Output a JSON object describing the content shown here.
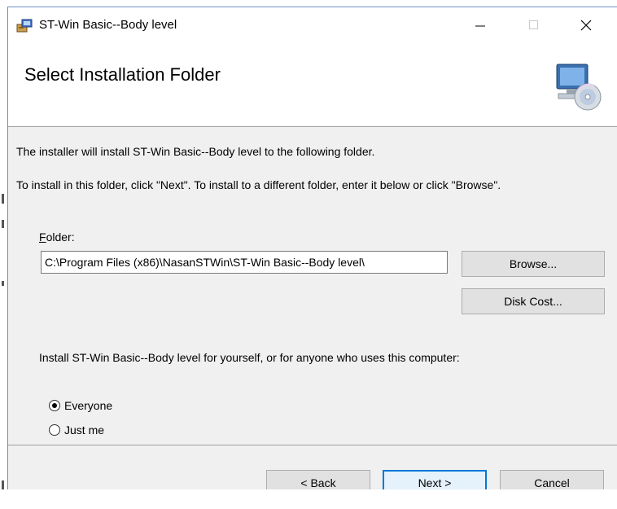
{
  "window": {
    "title": "ST-Win Basic--Body level",
    "controls": {
      "minimize": "—",
      "maximize": "☐",
      "close": "✕"
    }
  },
  "header": {
    "title": "Select Installation Folder",
    "icon": "computer-disc-icon"
  },
  "body": {
    "intro": "The installer will install ST-Win Basic--Body level to the following folder.",
    "instructions": "To install in this folder, click \"Next\". To install to a different folder, enter it below or click \"Browse\".",
    "folder_label_accel": "F",
    "folder_label_rest": "older:",
    "folder_value": "C:\\Program Files (x86)\\NasanSTWin\\ST-Win Basic--Body level\\",
    "browse_label": "Browse...",
    "disk_cost_label": "Disk Cost...",
    "install_for_label": "Install ST-Win Basic--Body level for yourself, or for anyone who uses this computer:",
    "options": [
      {
        "label": "Everyone",
        "checked": true
      },
      {
        "label": "Just me",
        "checked": false
      }
    ]
  },
  "footer": {
    "back_label": "< Back",
    "next_label": "Next >",
    "cancel_label": "Cancel"
  },
  "colors": {
    "accent": "#0078d7",
    "dialog_bg": "#f0f0f0"
  }
}
